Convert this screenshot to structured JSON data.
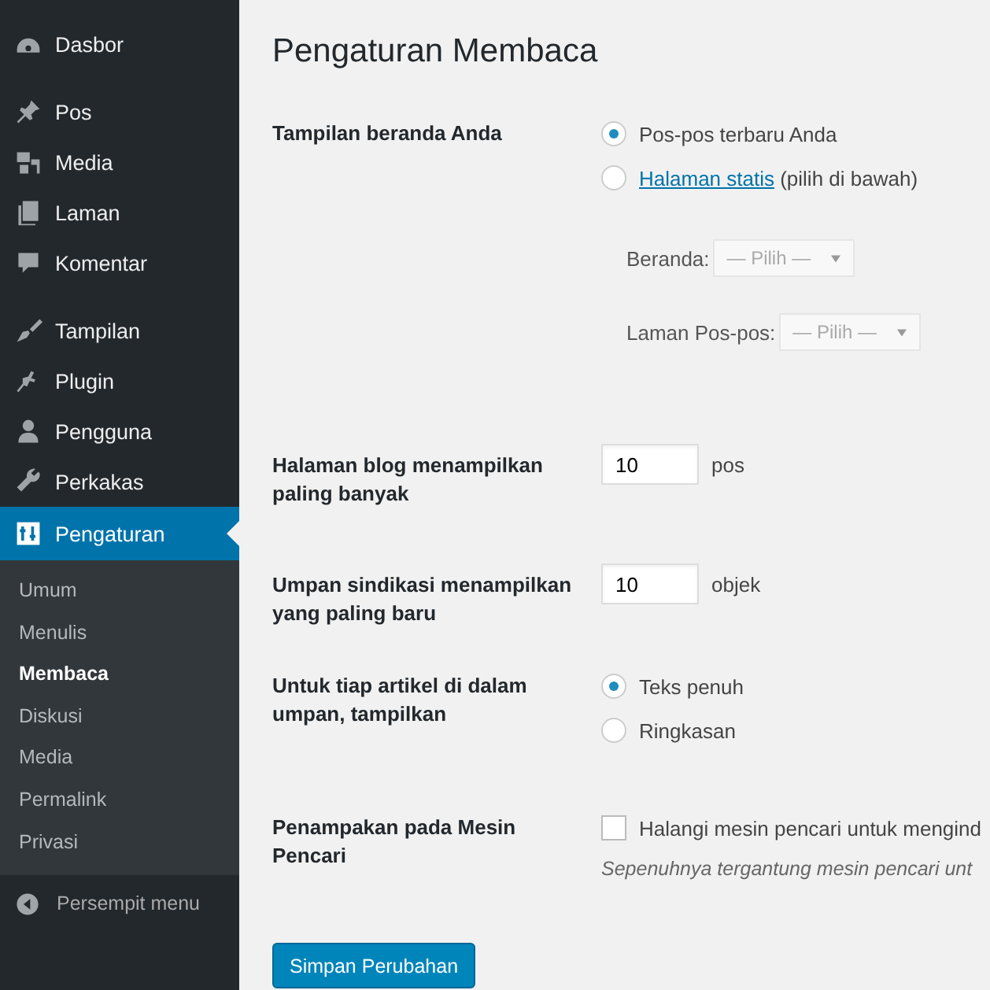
{
  "sidebar": {
    "items": [
      {
        "label": "Dasbor",
        "selected": false
      },
      {
        "label": "Pos",
        "selected": false
      },
      {
        "label": "Media",
        "selected": false
      },
      {
        "label": "Laman",
        "selected": false
      },
      {
        "label": "Komentar",
        "selected": false
      },
      {
        "label": "Tampilan",
        "selected": false
      },
      {
        "label": "Plugin",
        "selected": false
      },
      {
        "label": "Pengguna",
        "selected": false
      },
      {
        "label": "Perkakas",
        "selected": false
      },
      {
        "label": "Pengaturan",
        "selected": true
      }
    ],
    "submenu": [
      {
        "label": "Umum",
        "selected": false
      },
      {
        "label": "Menulis",
        "selected": false
      },
      {
        "label": "Membaca",
        "selected": true
      },
      {
        "label": "Diskusi",
        "selected": false
      },
      {
        "label": "Media",
        "selected": false
      },
      {
        "label": "Permalink",
        "selected": false
      },
      {
        "label": "Privasi",
        "selected": false
      }
    ],
    "collapse": "Persempit menu"
  },
  "page": {
    "title": "Pengaturan Membaca",
    "settings": [
      {
        "kind": "radio_group",
        "label": "Tampilan beranda Anda",
        "options": [
          {
            "text": "Pos-pos terbaru Anda",
            "selected": true
          },
          {
            "link": "Halaman statis",
            "text": " (pilih di bawah)",
            "selected": false
          }
        ],
        "selects": [
          {
            "label": "Beranda:",
            "value": "— Pilih —",
            "disabled": true
          },
          {
            "label": "Laman Pos-pos:",
            "value": "— Pilih —",
            "disabled": true
          }
        ]
      },
      {
        "kind": "number",
        "label": "Halaman blog menampilkan paling banyak",
        "value": "10",
        "unit": "pos"
      },
      {
        "kind": "number",
        "label": "Umpan sindikasi menampilkan yang paling baru",
        "value": "10",
        "unit": "objek"
      },
      {
        "kind": "radio_group",
        "label": "Untuk tiap artikel di dalam umpan, tampilkan",
        "options": [
          {
            "text": "Teks penuh",
            "selected": true
          },
          {
            "text": "Ringkasan",
            "selected": false
          }
        ]
      },
      {
        "kind": "checkbox",
        "label": "Penampakan pada Mesin Pencari",
        "text": "Halangi mesin pencari untuk mengind",
        "checked": false,
        "description": "Sepenuhnya tergantung mesin pencari unt"
      }
    ],
    "save_button": "Simpan Perubahan"
  }
}
